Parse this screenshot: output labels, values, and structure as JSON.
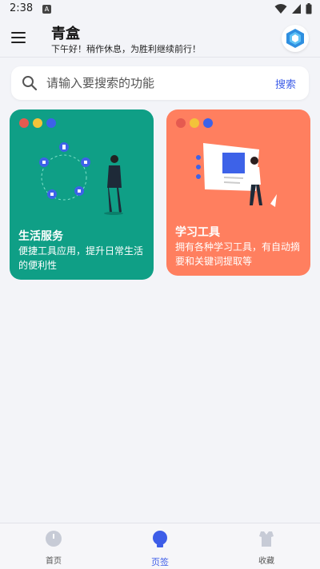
{
  "status_bar": {
    "time": "2:38",
    "notification": "A"
  },
  "header": {
    "title": "青盒",
    "subtitle": "下午好！稍作休息，为胜利继续前行！"
  },
  "search": {
    "placeholder": "请输入要搜索的功能",
    "button_label": "搜索"
  },
  "cards": [
    {
      "title": "生活服务",
      "description": "便捷工具应用，提升日常生活的便利性",
      "color": "#0f9f86"
    },
    {
      "title": "学习工具",
      "description": "拥有各种学习工具，有自动摘要和关键词提取等",
      "color": "#ff7f5f"
    }
  ],
  "bottom_nav": {
    "items": [
      {
        "label": "首页",
        "icon": "clock-icon"
      },
      {
        "label": "页签",
        "icon": "bulb-icon",
        "active": true
      },
      {
        "label": "收藏",
        "icon": "shirt-icon"
      }
    ]
  },
  "colors": {
    "accent": "#3d5de8",
    "background": "#f3f4f8"
  }
}
